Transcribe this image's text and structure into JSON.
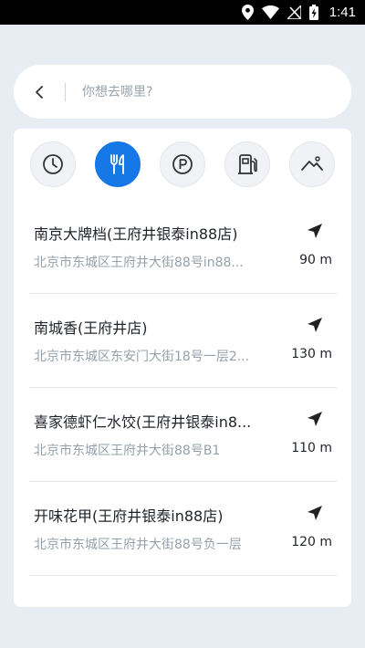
{
  "status_bar": {
    "time": "1:41",
    "icons": [
      "location-icon",
      "wifi-icon",
      "no-signal-icon",
      "battery-charging-icon"
    ]
  },
  "search": {
    "placeholder": "你想去哪里?"
  },
  "categories": [
    {
      "name": "history-icon",
      "active": false
    },
    {
      "name": "restaurant-icon",
      "active": true
    },
    {
      "name": "parking-icon",
      "active": false
    },
    {
      "name": "gas-station-icon",
      "active": false
    },
    {
      "name": "scenic-spot-icon",
      "active": false
    }
  ],
  "results": [
    {
      "name": "南京大牌档(王府井银泰in88店)",
      "address": "北京市东城区王府井大街88号in88...",
      "distance": "90 m"
    },
    {
      "name": "南城香(王府井店)",
      "address": "北京市东城区东安门大街18号一层2...",
      "distance": "130 m"
    },
    {
      "name": "喜家德虾仁水饺(王府井银泰in8...",
      "address": "北京市东城区王府井大街88号B1",
      "distance": "110 m"
    },
    {
      "name": "开味花甲(王府井银泰in88店)",
      "address": "北京市东城区王府井大街88号负一层",
      "distance": "120 m"
    }
  ],
  "colors": {
    "accent": "#1677e6",
    "background": "#e8edf4"
  }
}
